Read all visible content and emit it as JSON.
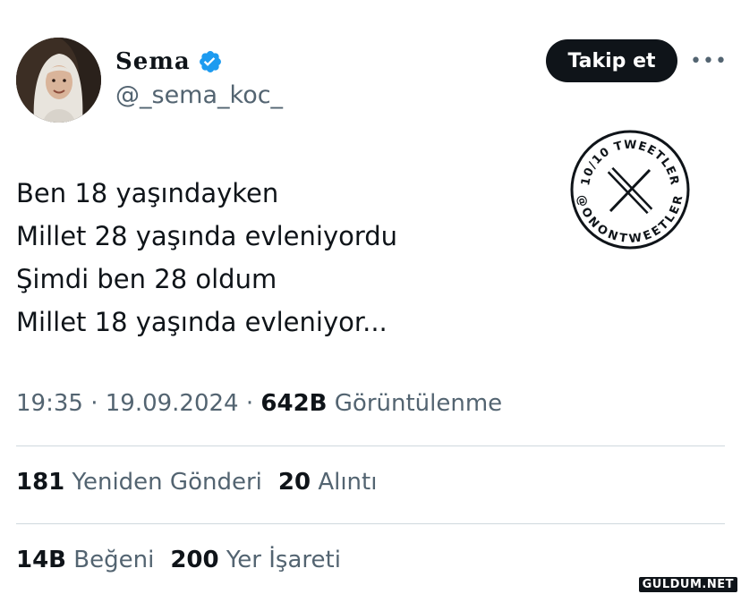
{
  "profile": {
    "display_name": "Sema",
    "handle": "@_sema_koc_",
    "verified_icon": "verified-badge-icon",
    "accent_color": "#1d9bf0"
  },
  "actions": {
    "follow_label": "Takip et",
    "more_label": "•••"
  },
  "tweet": {
    "lines": [
      "Ben 18 yaşındayken",
      "Millet 28 yaşında evleniyordu",
      "Şimdi ben 28 oldum",
      "Millet 18 yaşında evleniyor..."
    ]
  },
  "stamp": {
    "top_text": "10/10 TWEETLER",
    "bottom_text": "@ONONTWEETLER",
    "center_icon": "x-logo-icon"
  },
  "meta": {
    "time": "19:35",
    "separator": "·",
    "date": "19.09.2024",
    "views_count": "642B",
    "views_label": "Görüntülenme"
  },
  "stats": {
    "reposts_count": "181",
    "reposts_label": "Yeniden Gönderi",
    "quotes_count": "20",
    "quotes_label": "Alıntı",
    "likes_count": "14B",
    "likes_label": "Beğeni",
    "bookmarks_count": "200",
    "bookmarks_label": "Yer İşareti"
  },
  "watermark": "GULDUM.NET",
  "colors": {
    "text_primary": "#0f1419",
    "text_secondary": "#536471",
    "divider": "#cfd9de",
    "button_bg": "#0f1419"
  }
}
